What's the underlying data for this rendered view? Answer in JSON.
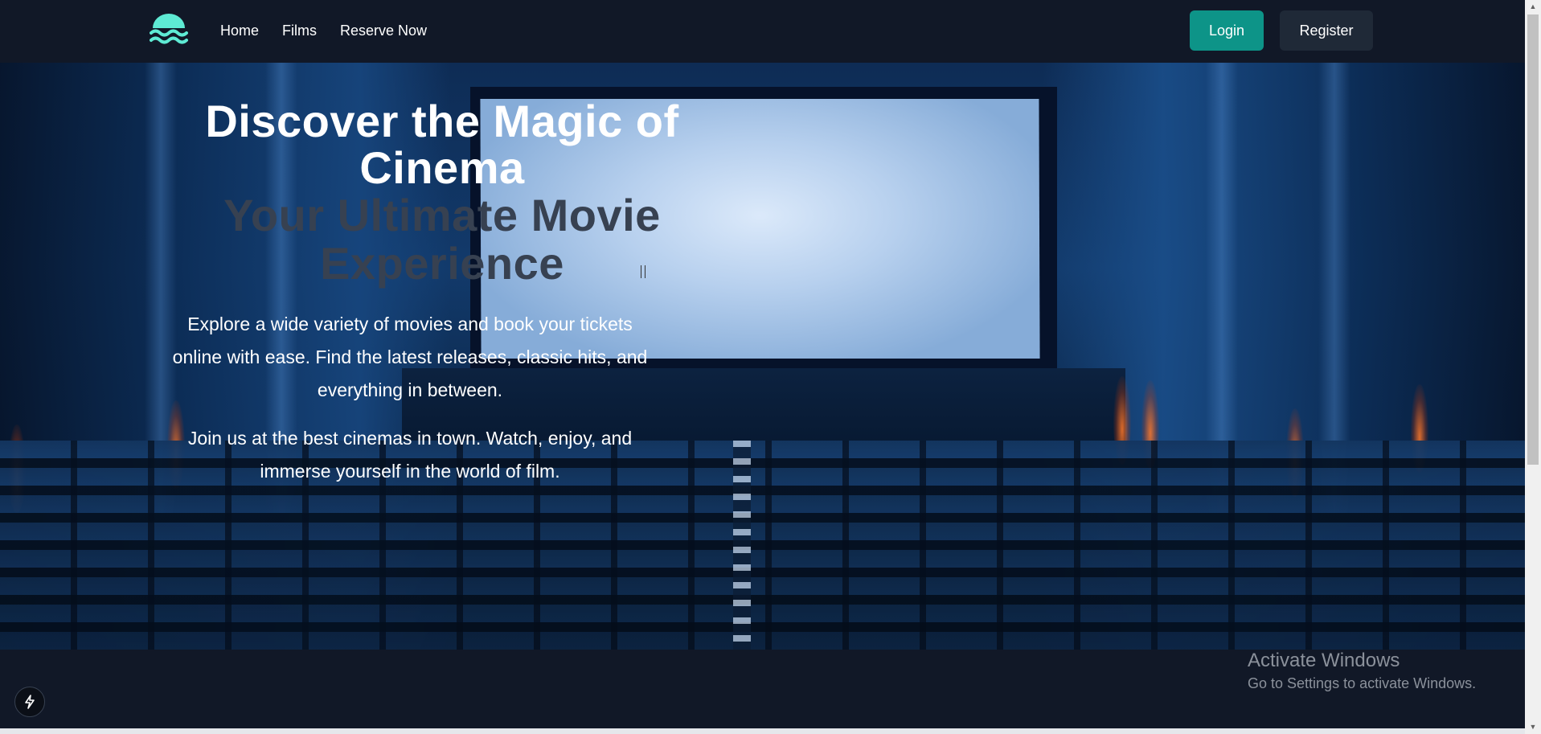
{
  "header": {
    "logo_icon": "wave-logo-icon",
    "nav": [
      "Home",
      "Films",
      "Reserve Now"
    ],
    "login_label": "Login",
    "register_label": "Register"
  },
  "hero": {
    "title": "Discover the Magic of Cinema",
    "subtitle": "Your Ultimate Movie Experience",
    "paragraph_1": "Explore a wide variety of movies and book your tickets online with ease. Find the latest releases, classic hits, and everything in between.",
    "paragraph_2": "Join us at the best cinemas in town. Watch, enjoy, and immerse yourself in the world of film.",
    "background_image": "cinema-auditorium-image"
  },
  "floating": {
    "bolt_icon": "lightning-bolt-icon"
  },
  "watermark": {
    "line1": "Activate Windows",
    "line2": "Go to Settings to activate Windows."
  },
  "colors": {
    "header_bg": "#111827",
    "accent": "#0d9488",
    "logo": "#5eead4",
    "register_bg": "#1f2937",
    "subtitle": "#374151"
  }
}
